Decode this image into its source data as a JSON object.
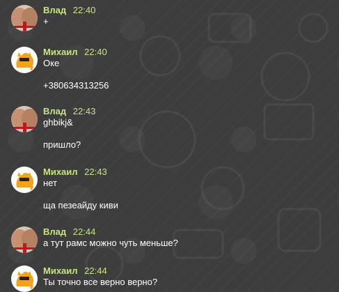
{
  "colors": {
    "background": "#3d3d3d",
    "author_name": "#c6e584",
    "message_text": "#ffffff"
  },
  "messages": [
    {
      "author": "Влад",
      "time": "22:40",
      "avatar": "vlad-avatar",
      "lines": [
        "+"
      ]
    },
    {
      "author": "Михаил",
      "time": "22:40",
      "avatar": "mikhail-avatar",
      "lines": [
        "Оке",
        "",
        "+380634313256"
      ]
    },
    {
      "author": "Влад",
      "time": "22:43",
      "avatar": "vlad-avatar",
      "lines": [
        "ghbikj&",
        "",
        "пришло?"
      ]
    },
    {
      "author": "Михаил",
      "time": "22:43",
      "avatar": "mikhail-avatar",
      "lines": [
        "нет",
        "",
        "ща пезеайду киви"
      ]
    },
    {
      "author": "Влад",
      "time": "22:44",
      "avatar": "vlad-avatar",
      "lines": [
        "а тут рамс можно чуть меньше?"
      ]
    },
    {
      "author": "Михаил",
      "time": "22:44",
      "avatar": "mikhail-avatar",
      "lines": [
        "Ты точно все верно верно?"
      ]
    }
  ]
}
